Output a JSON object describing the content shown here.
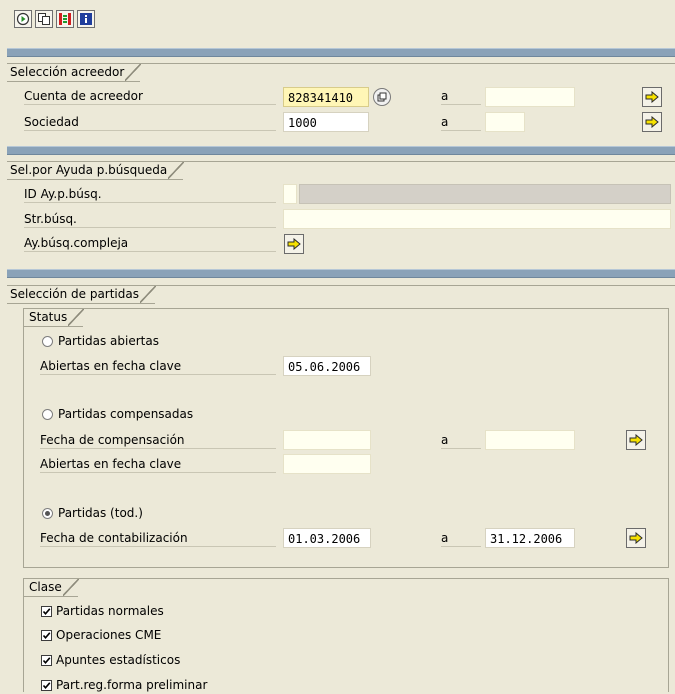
{
  "toolbar": {
    "icons": [
      "execute-icon",
      "copy-icon",
      "selection-options-icon",
      "info-icon"
    ]
  },
  "vendor_selection": {
    "title": "Selección acreedor",
    "account_label": "Cuenta de acreedor",
    "account_value": "828341410",
    "account_to_label": "a",
    "account_to_value": "",
    "company_label": "Sociedad",
    "company_value": "1000",
    "company_to_label": "a",
    "company_to_value": ""
  },
  "search_help": {
    "title": "Sel.por Ayuda p.búsqueda",
    "id_label": "ID Ay.p.búsq.",
    "id_value": "",
    "search_string_label": "Str.búsq.",
    "search_string_value": "",
    "complex_label": "Ay.búsq.compleja"
  },
  "item_selection": {
    "title": "Selección de partidas",
    "status": {
      "title": "Status",
      "open_items_label": "Partidas abiertas",
      "open_items_selected": false,
      "open_key_date_label": "Abiertas en fecha clave",
      "open_key_date_value": "05.06.2006",
      "cleared_items_label": "Partidas compensadas",
      "cleared_items_selected": false,
      "clearing_date_label": "Fecha de compensación",
      "clearing_date_from": "",
      "clearing_date_to_label": "a",
      "clearing_date_to": "",
      "cleared_key_date_label": "Abiertas en fecha clave",
      "cleared_key_date_value": "",
      "all_items_label": "Partidas (tod.)",
      "all_items_selected": true,
      "posting_date_label": "Fecha de contabilización",
      "posting_date_from": "01.03.2006",
      "posting_date_to_label": "a",
      "posting_date_to": "31.12.2006"
    },
    "type": {
      "title": "Clase",
      "normal_items_label": "Partidas normales",
      "normal_items_checked": true,
      "special_gl_label": "Operaciones CME",
      "special_gl_checked": true,
      "statistical_label": "Apuntes estadísticos",
      "statistical_checked": true,
      "parked_label": "Part.reg.forma preliminar",
      "parked_checked": true
    }
  },
  "colors": {
    "background": "#ece9d8",
    "separator": "#8aa2b8",
    "input": "#fffff0",
    "focused_input": "#fff6b6"
  }
}
